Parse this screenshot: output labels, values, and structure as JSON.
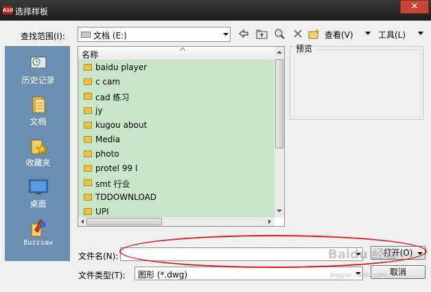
{
  "titlebar": {
    "logo_text": "A10",
    "title": "选择样板",
    "close_icon": "✕"
  },
  "lookin": {
    "label": "查找范围(I):",
    "value": "文档 (E:)"
  },
  "toolbar": {
    "view_label": "查看(V)",
    "tools_label": "工具(L)"
  },
  "places": [
    {
      "label": "历史记录",
      "icon": "history-icon"
    },
    {
      "label": "文档",
      "icon": "documents-icon"
    },
    {
      "label": "收藏夹",
      "icon": "favorites-icon"
    },
    {
      "label": "桌面",
      "icon": "desktop-icon"
    },
    {
      "label": "Buzzsaw",
      "icon": "buzzsaw-icon"
    }
  ],
  "filelist": {
    "column_header": "名称",
    "items": [
      "baidu player",
      "c cam",
      "cad 练习",
      "jy",
      "kugou about",
      "Media",
      "photo",
      "protel 99 l",
      "smt 行业",
      "TDDOWNLOAD",
      "UPI"
    ]
  },
  "preview": {
    "label": "预览"
  },
  "filename": {
    "label": "文件名(N):",
    "value": ""
  },
  "filetype": {
    "label": "文件类型(T):",
    "value": "图形 (*.dwg)"
  },
  "buttons": {
    "open_label": "打开(O)",
    "cancel_label": "取消"
  },
  "watermark": {
    "text": "Baidu 经验",
    "sub": "jingyan.baidu.com"
  },
  "colors": {
    "places_bg": "#6b8fb0",
    "list_selection": "#cae6c9",
    "annotation_red": "#e0141a"
  }
}
